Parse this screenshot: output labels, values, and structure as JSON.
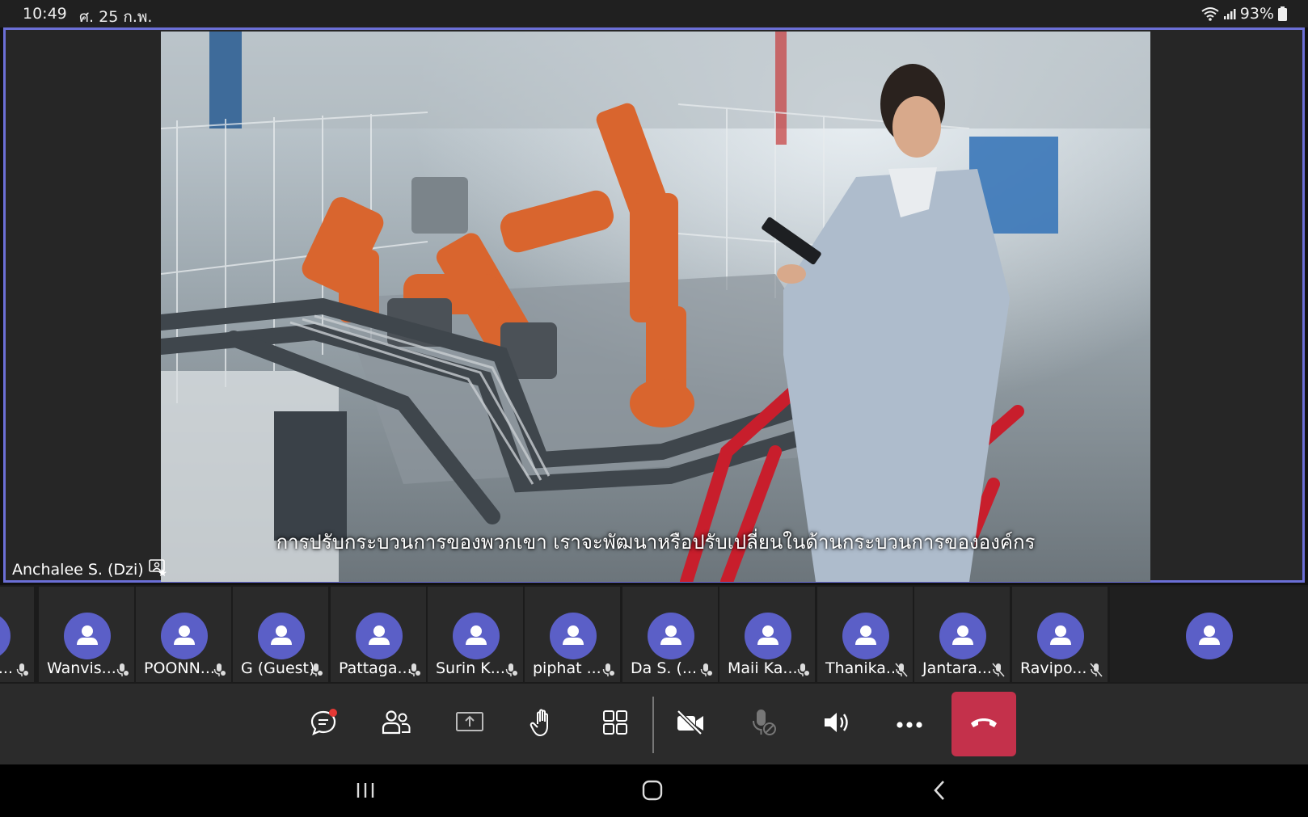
{
  "status": {
    "time": "10:49",
    "date": "ศ. 25 ก.พ.",
    "battery": "93%"
  },
  "stage": {
    "speaker_name": "Anchalee S. (Dzi)",
    "caption": "การปรับกระบวนการของพวกเขา เราจะพัฒนาหรือปรับเปลี่ยนในด้านกระบวนการขององค์กร"
  },
  "participants": [
    {
      "name": "g ...",
      "muted": false
    },
    {
      "name": "Wanvis...",
      "muted": false
    },
    {
      "name": "POONN...",
      "muted": false
    },
    {
      "name": "G (Guest)",
      "muted": false
    },
    {
      "name": "Pattaga...",
      "muted": false
    },
    {
      "name": "Surin K...",
      "muted": false
    },
    {
      "name": "piphat ...",
      "muted": false
    },
    {
      "name": "Da S. (...",
      "muted": false
    },
    {
      "name": "Maii Ka...",
      "muted": false
    },
    {
      "name": "Thanika...",
      "muted": true
    },
    {
      "name": "Jantara...",
      "muted": true
    },
    {
      "name": "Ravipo...",
      "muted": true
    },
    {
      "name": "",
      "muted": false
    }
  ],
  "controls": {
    "chat": "chat-icon",
    "people": "people-icon",
    "share": "share-icon",
    "raise_hand": "raise-hand-icon",
    "layout": "layout-icon",
    "camera": "camera-off-icon",
    "mic": "mic-off-icon",
    "speaker": "speaker-icon",
    "more": "more-icon",
    "hangup": "hangup-icon"
  },
  "colors": {
    "accent": "#6b6fd6",
    "avatar": "#5b5fc7",
    "hangup": "#c4314b",
    "notification": "#e53935"
  }
}
